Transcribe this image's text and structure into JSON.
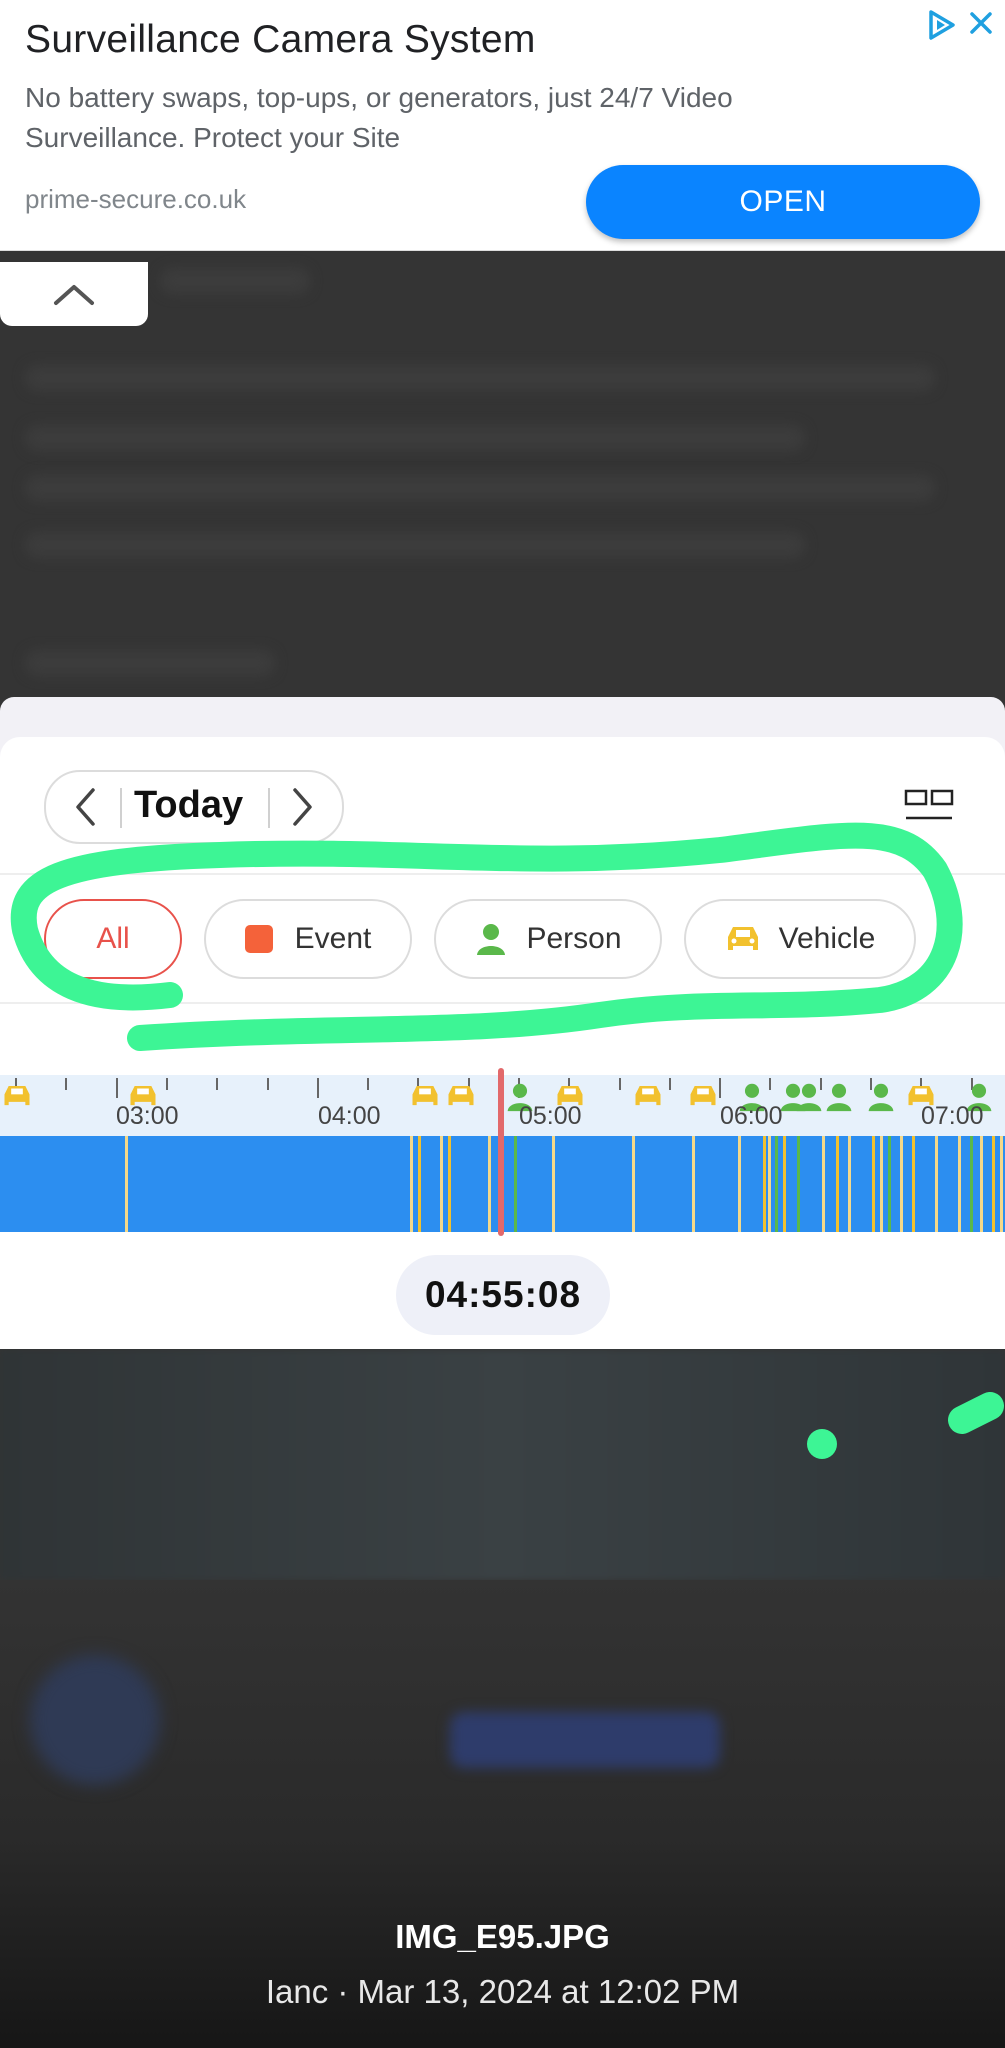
{
  "ad": {
    "title": "Surveillance Camera System",
    "description": "No battery swaps, top-ups, or generators, just 24/7 Video Surveillance. Protect your Site",
    "domain": "prime-secure.co.uk",
    "open_label": "OPEN",
    "adchoices_icon": "adchoices-icon",
    "close_icon": "close-icon",
    "accent": "#0a84ff"
  },
  "camera_app": {
    "date_nav": {
      "label": "Today",
      "prev_icon": "chevron-left-icon",
      "next_icon": "chevron-right-icon"
    },
    "layout_icon": "grid-layout-icon",
    "filters": [
      {
        "label": "All",
        "selected": true,
        "color": "#e8524b"
      },
      {
        "label": "Event",
        "icon": "event-square-icon",
        "color": "#f4623a"
      },
      {
        "label": "Person",
        "icon": "person-icon",
        "color": "#5ab84a"
      },
      {
        "label": "Vehicle",
        "icon": "car-icon",
        "color": "#f2c12e"
      }
    ],
    "timeline": {
      "hour_labels": [
        "03:00",
        "04:00",
        "05:00",
        "06:00",
        "07:00"
      ],
      "current_time": "04:55:08",
      "track_color": "#2c8ef0",
      "playhead_color": "#e2696b"
    }
  },
  "annotation_color": "#3df595",
  "photo_viewer": {
    "file_name": "IMG_E95.JPG",
    "meta": "Ianc · Mar 13, 2024 at 12:02 PM"
  }
}
